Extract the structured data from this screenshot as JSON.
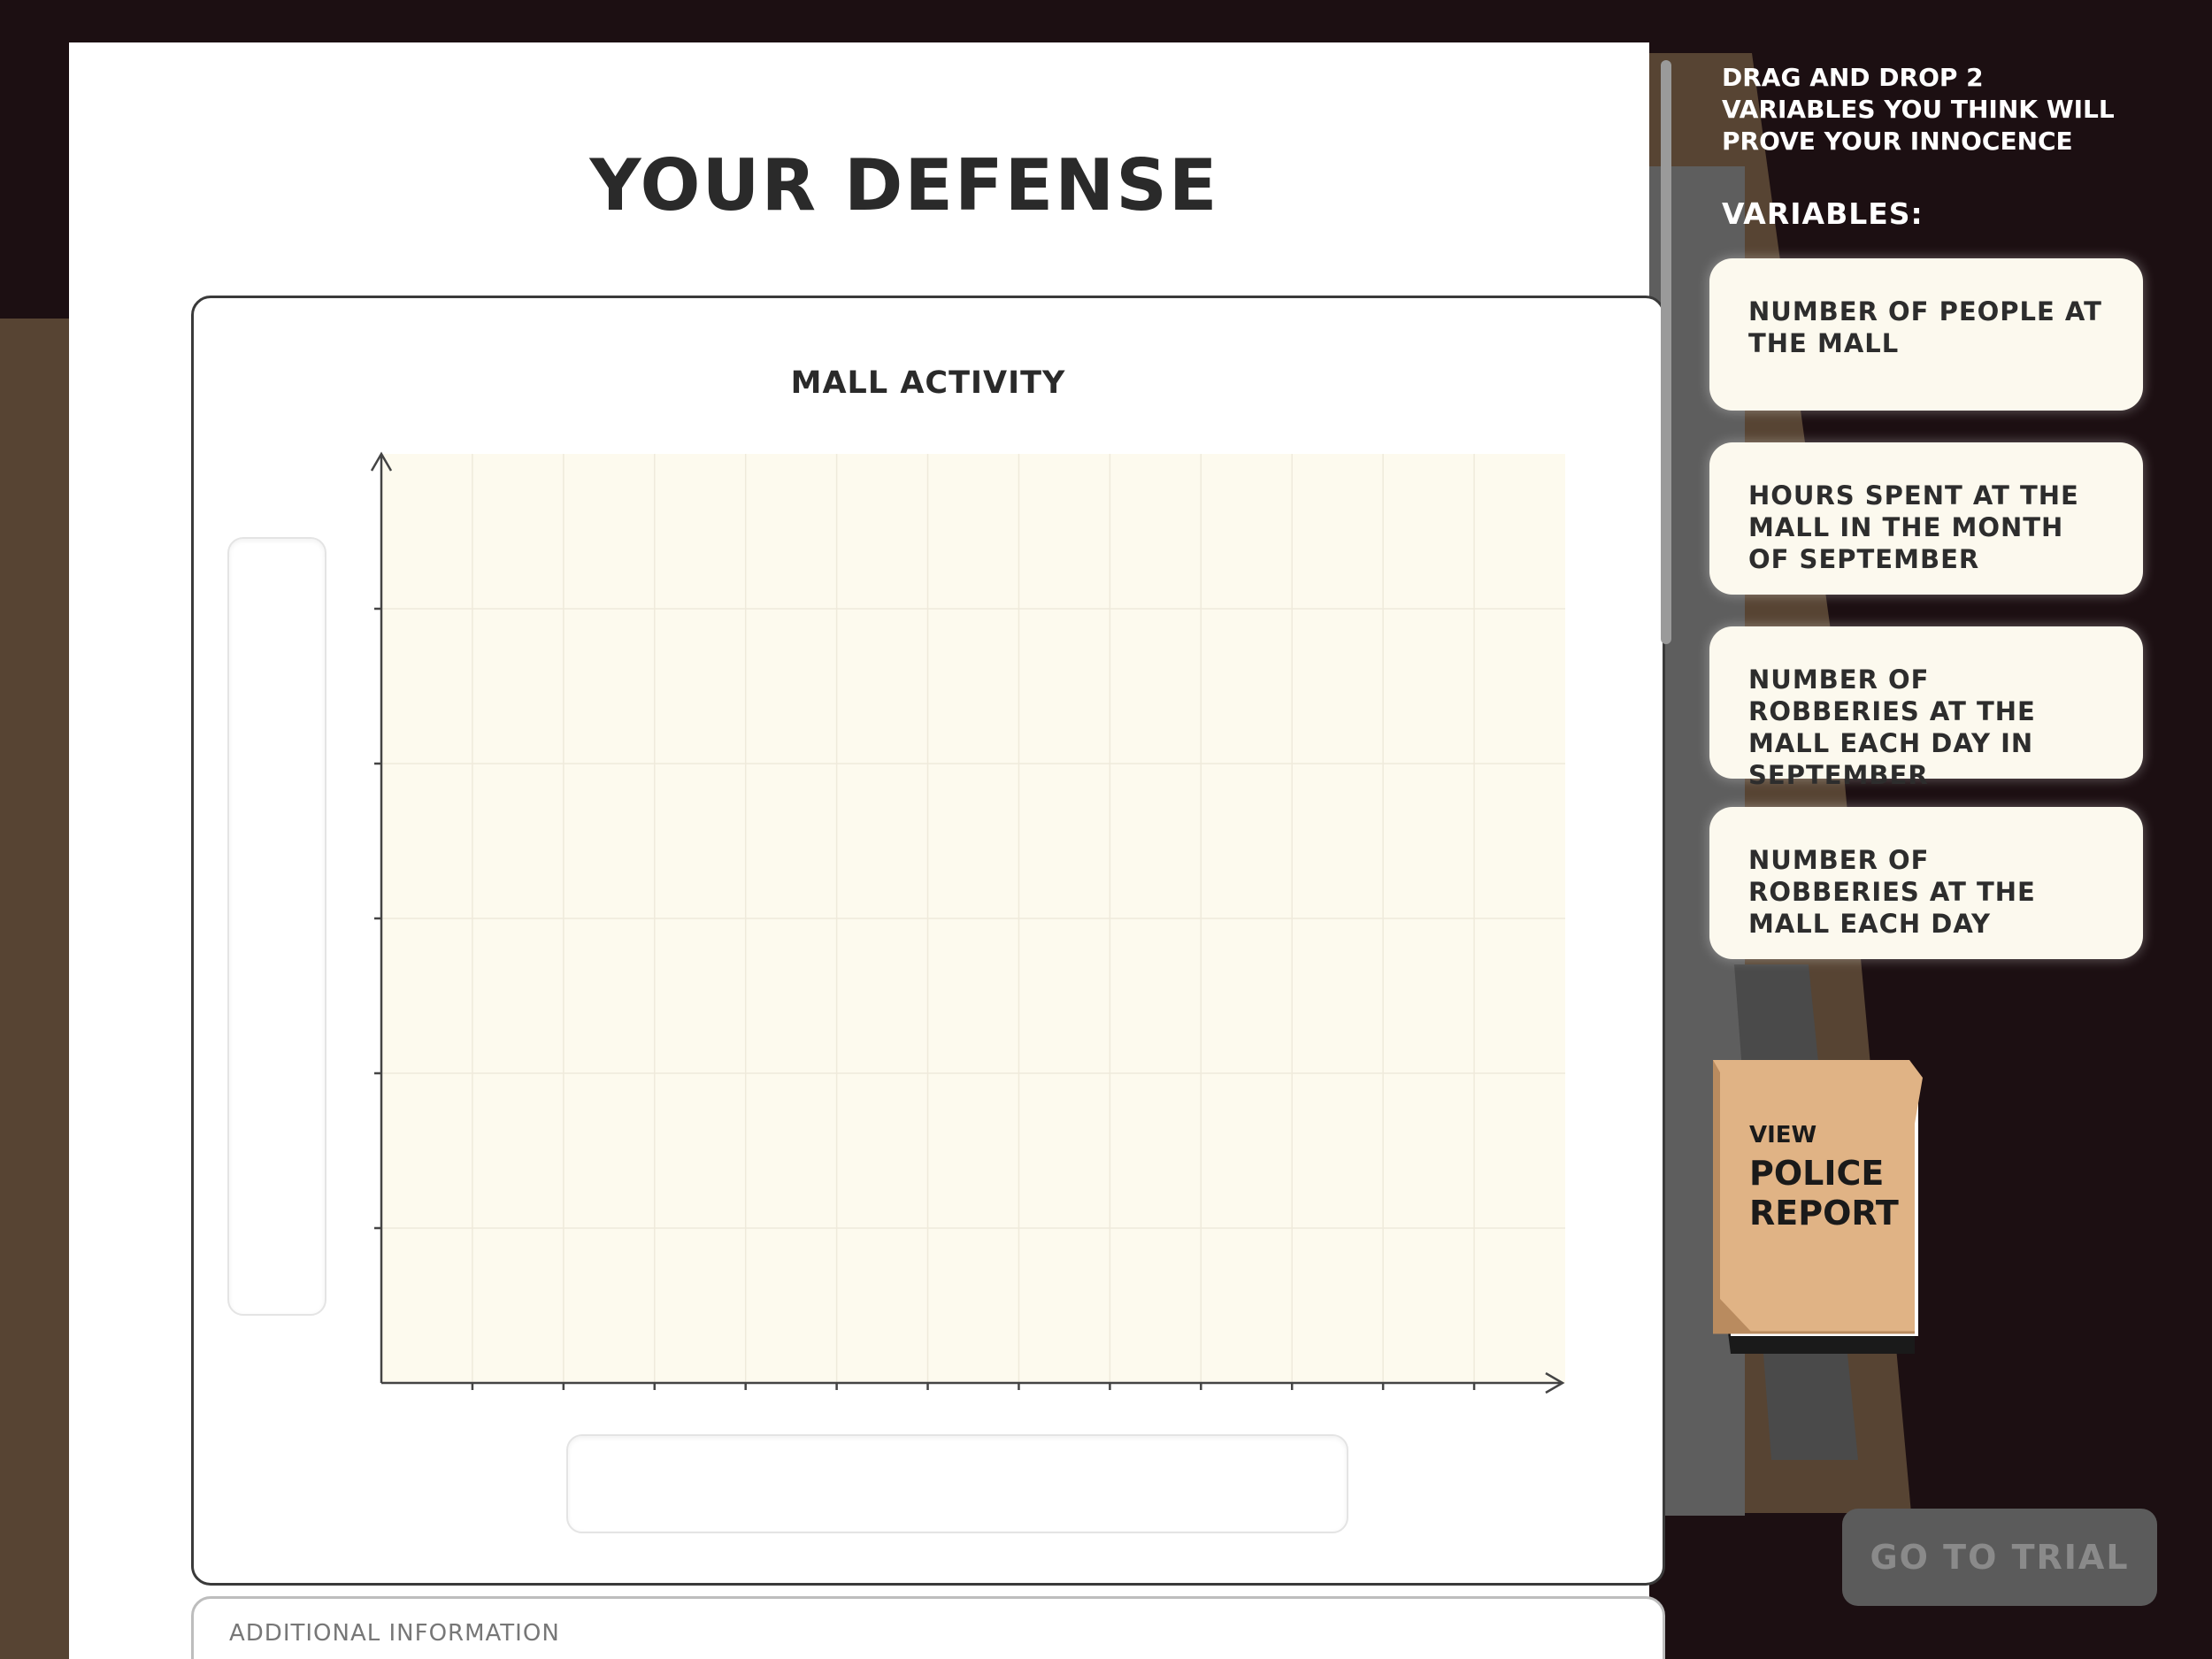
{
  "page": {
    "title": "YOUR DEFENSE"
  },
  "graph": {
    "title": "MALL ACTIVITY",
    "y_axis_label": "",
    "x_axis_label": "",
    "plot_bg_color": "#fdfaee",
    "axis_color": "#444444"
  },
  "additional_info": {
    "label": "ADDITIONAL INFORMATION"
  },
  "sidebar": {
    "instructions": "DRAG AND DROP 2 VARIABLES YOU THINK WILL PROVE YOUR INNOCENCE",
    "variables_label": "VARIABLES:",
    "variables": [
      {
        "label": "NUMBER OF PEOPLE AT THE MALL"
      },
      {
        "label": "HOURS SPENT AT THE MALL IN THE MONTH OF SEPTEMBER"
      },
      {
        "label": "NUMBER OF ROBBERIES AT THE MALL EACH DAY IN SEPTEMBER"
      },
      {
        "label": "NUMBER OF ROBBERIES AT THE MALL EACH DAY"
      }
    ],
    "variable_card_color": "#fcf9ee"
  },
  "police_report": {
    "view_label": "VIEW",
    "title": "POLICE REPORT",
    "folder_color": "#e0b385"
  },
  "trial_button": {
    "label": "GO TO TRIAL",
    "state": "disabled"
  }
}
